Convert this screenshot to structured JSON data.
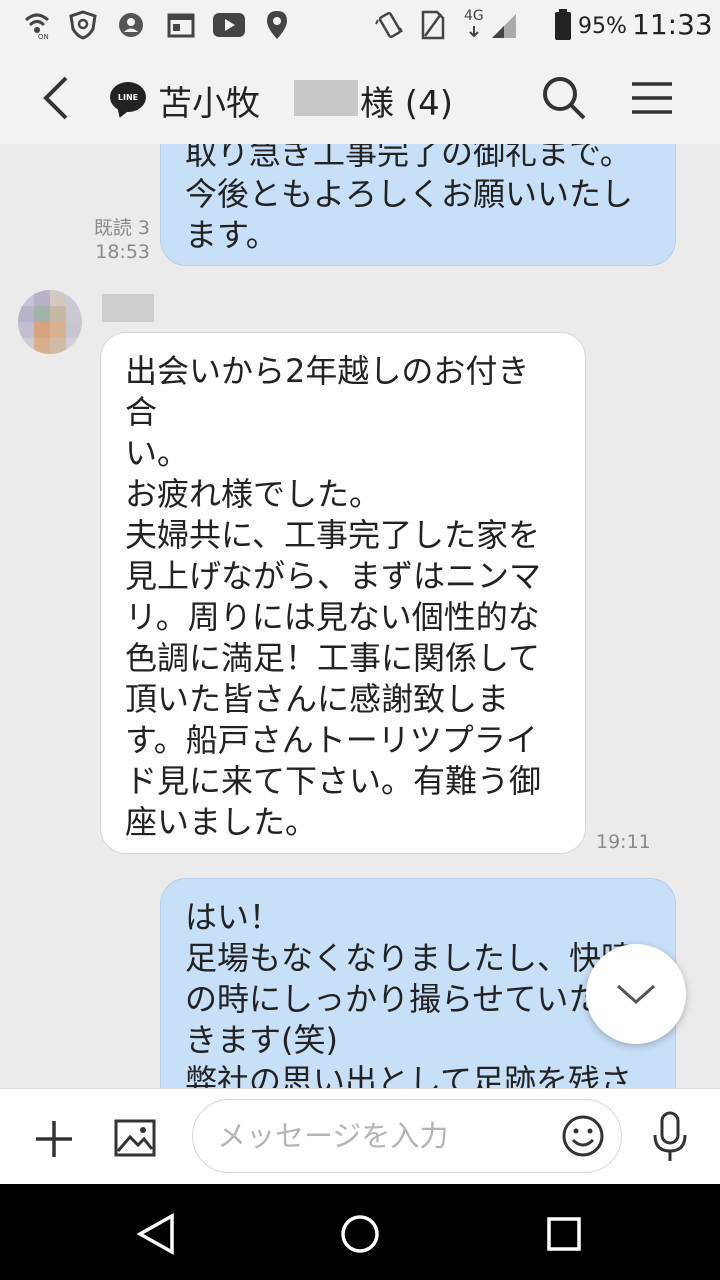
{
  "status_bar": {
    "battery": "95%",
    "time": "11:33",
    "network": "4G"
  },
  "header": {
    "app_logo": "LINE",
    "chat_name": "苫小牧",
    "chat_suffix": "様 (4)"
  },
  "messages": [
    {
      "direction": "outgoing",
      "text": "取り急ぎ工事完了の御礼まで。\n今後ともよろしくお願いいたし\nます。",
      "read_status": "既読 3",
      "time": "18:53"
    },
    {
      "direction": "incoming",
      "text": "出会いから2年越しのお付き合\nい。\nお疲れ様でした。\n夫婦共に、工事完了した家を\n見上げながら、まずはニンマ\nリ。周りには見ない個性的な\n色調に満足！工事に関係して\n頂いた皆さんに感謝致しま\nす。船戸さんトーリツプライ\nド見に来て下さい。有難う御\n座いました。",
      "time": "19:11"
    },
    {
      "direction": "outgoing",
      "text": "はい！\n足場もなくなりましたし、快晴\nの時にしっかり撮らせていただ\nきます(笑)\n弊社の思い出として足跡を残さ"
    }
  ],
  "input": {
    "placeholder": "メッセージを入力"
  },
  "colors": {
    "outgoing_bubble": "#c7dff7",
    "incoming_bubble": "#ffffff",
    "chat_background": "#ebebeb"
  },
  "icons": [
    "back-arrow-icon",
    "line-logo-icon",
    "search-icon",
    "menu-icon",
    "chevron-down-icon",
    "plus-icon",
    "image-icon",
    "emoji-icon",
    "microphone-icon",
    "nav-back-icon",
    "nav-home-icon",
    "nav-recents-icon"
  ]
}
